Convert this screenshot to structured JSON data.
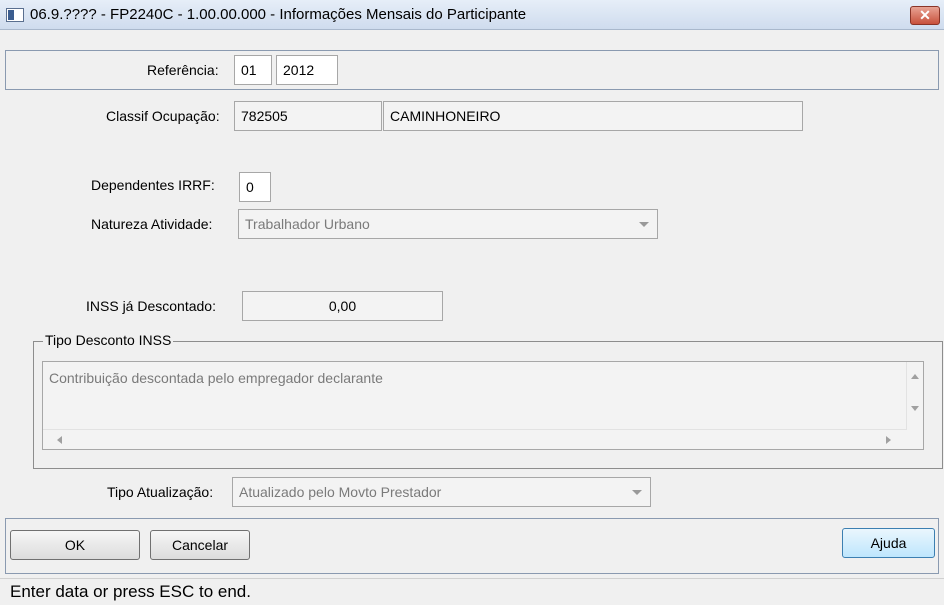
{
  "window": {
    "title": "06.9.???? - FP2240C - 1.00.00.000 - Informações Mensais do Participante",
    "close_symbol": "✕"
  },
  "referencia": {
    "label": "Referência:",
    "month": "01",
    "year": "2012"
  },
  "classif_ocupacao": {
    "label": "Classif Ocupação:",
    "code": "782505",
    "description": "CAMINHONEIRO"
  },
  "dependentes_irrf": {
    "label": "Dependentes IRRF:",
    "value": "0"
  },
  "natureza_atividade": {
    "label": "Natureza Atividade:",
    "value": "Trabalhador Urbano"
  },
  "inss_descontado": {
    "label": "INSS já Descontado:",
    "value": "0,00"
  },
  "tipo_desconto": {
    "group_title": "Tipo Desconto INSS",
    "text": "Contribuição descontada pelo empregador declarante"
  },
  "tipo_atualizacao": {
    "label": "Tipo Atualização:",
    "value": "Atualizado pelo Movto Prestador"
  },
  "buttons": {
    "ok": "OK",
    "cancelar": "Cancelar",
    "ajuda": "Ajuda"
  },
  "status": {
    "text": "Enter data or press ESC to end."
  },
  "colors": {
    "titlebar": "#cfdcee",
    "close": "#c8513c",
    "default_button": "#bee6fd"
  }
}
